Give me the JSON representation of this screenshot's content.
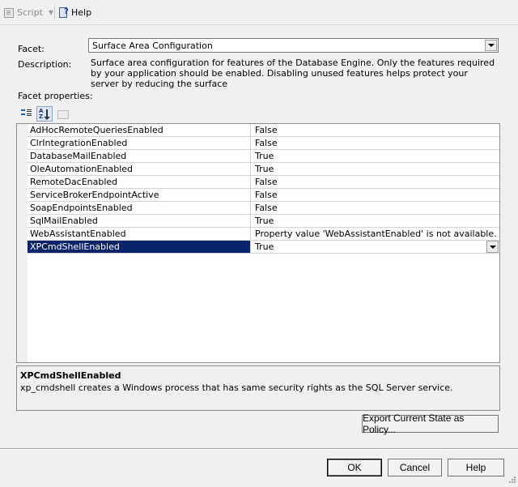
{
  "toolbar": {
    "script_label": "Script",
    "help_label": "Help"
  },
  "facet": {
    "label": "Facet:",
    "value": "Surface Area Configuration"
  },
  "description": {
    "label": "Description:",
    "text": "Surface area configuration for features of the Database Engine. Only the features required by your application should be enabled. Disabling unused features helps protect your server by reducing the surface"
  },
  "facet_properties_label": "Facet properties:",
  "properties": [
    {
      "name": "AdHocRemoteQueriesEnabled",
      "value": "False"
    },
    {
      "name": "ClrIntegrationEnabled",
      "value": "False"
    },
    {
      "name": "DatabaseMailEnabled",
      "value": "True"
    },
    {
      "name": "OleAutomationEnabled",
      "value": "True"
    },
    {
      "name": "RemoteDacEnabled",
      "value": "False"
    },
    {
      "name": "ServiceBrokerEndpointActive",
      "value": "False"
    },
    {
      "name": "SoapEndpointsEnabled",
      "value": "False"
    },
    {
      "name": "SqlMailEnabled",
      "value": "True"
    },
    {
      "name": "WebAssistantEnabled",
      "value": "Property value 'WebAssistantEnabled' is not available."
    },
    {
      "name": "XPCmdShellEnabled",
      "value": "True"
    }
  ],
  "help_panel": {
    "title": "XPCmdShellEnabled",
    "text": "xp_cmdshell creates a Windows process that has same security rights as the SQL Server service."
  },
  "buttons": {
    "export": "Export Current State as Policy...",
    "ok": "OK",
    "cancel": "Cancel",
    "help": "Help"
  }
}
